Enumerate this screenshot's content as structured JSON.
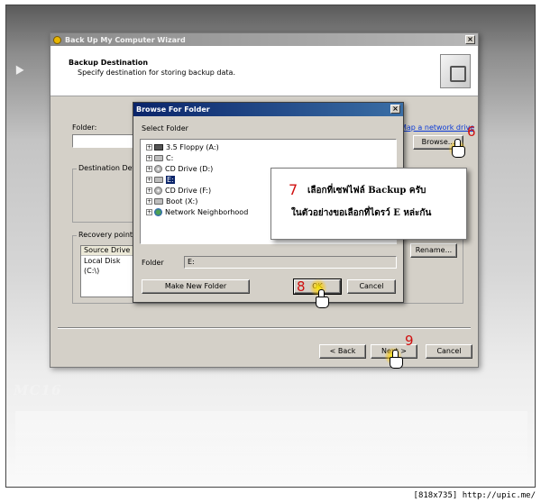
{
  "wizard": {
    "title": "Back Up My Computer Wizard",
    "header_title": "Backup Destination",
    "header_subtitle": "Specify destination for storing backup data.",
    "folder_label": "Folder:",
    "network_link": "Map a network drive",
    "browse_button": "Browse...",
    "destination_group": "Destination Details",
    "recovery_group": "Recovery point file",
    "recovery_columns": [
      "Source Drive"
    ],
    "recovery_rows": [
      "Local Disk (C:\\)"
    ],
    "rename_button": "Rename...",
    "back_button": "< Back",
    "next_button": "Next >",
    "cancel_button": "Cancel",
    "close_glyph": "×"
  },
  "browse_dialog": {
    "title": "Browse For Folder",
    "instruction": "Select Folder",
    "tree_items": [
      {
        "label": "3.5 Floppy (A:)",
        "icon": "floppy-icon",
        "selected": false
      },
      {
        "label": "C:",
        "icon": "drive-icon",
        "selected": false
      },
      {
        "label": "CD Drive (D:)",
        "icon": "cd-icon",
        "selected": false
      },
      {
        "label": "E:",
        "icon": "drive-icon",
        "selected": true
      },
      {
        "label": "CD Drive (F:)",
        "icon": "cd-icon",
        "selected": false
      },
      {
        "label": "Boot (X:)",
        "icon": "drive-icon",
        "selected": false
      },
      {
        "label": "Network Neighborhood",
        "icon": "network-icon",
        "selected": false
      }
    ],
    "folder_label": "Folder",
    "folder_value": "E:",
    "make_new_folder_button": "Make New Folder",
    "ok_button": "OK",
    "cancel_button": "Cancel",
    "close_glyph": "×",
    "expand_glyph": "+"
  },
  "annotations": {
    "callout_number": "7",
    "callout_line1": "เลือกที่เซฟไฟล์ Backup ครับ",
    "callout_line2": "ในตัวอย่างขอเลือกที่ไดรว์ E หล่ะกัน",
    "step6": "6",
    "step8": "8",
    "step9": "9"
  },
  "watermark": "MC16",
  "footer": "[818x735] http://upic.me/"
}
